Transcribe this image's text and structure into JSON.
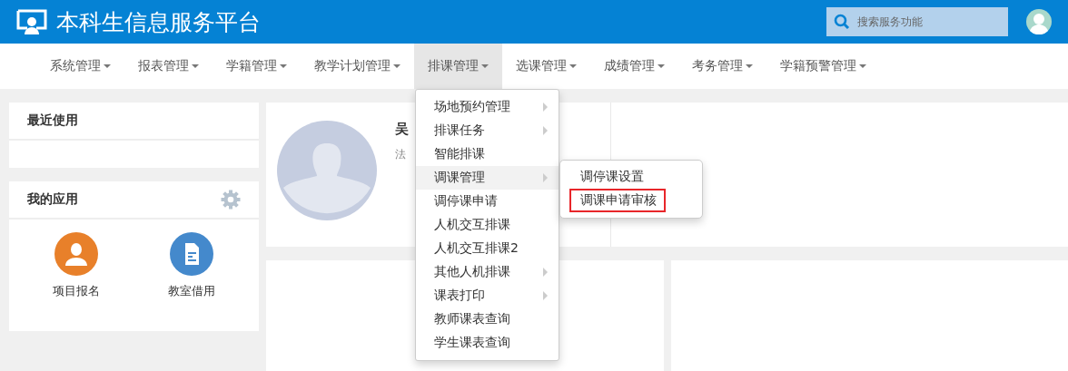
{
  "header": {
    "title": "本科生信息服务平台",
    "search": {
      "placeholder": "搜索服务功能"
    }
  },
  "nav": [
    {
      "label": "系统管理",
      "selected": false
    },
    {
      "label": "报表管理",
      "selected": false
    },
    {
      "label": "学籍管理",
      "selected": false
    },
    {
      "label": "教学计划管理",
      "selected": false
    },
    {
      "label": "排课管理",
      "selected": true
    },
    {
      "label": "选课管理",
      "selected": false
    },
    {
      "label": "成绩管理",
      "selected": false
    },
    {
      "label": "考务管理",
      "selected": false
    },
    {
      "label": "学籍预警管理",
      "selected": false
    }
  ],
  "dropdown": [
    {
      "label": "场地预约管理",
      "has_submenu": true,
      "expanded": false
    },
    {
      "label": "排课任务",
      "has_submenu": true,
      "expanded": false
    },
    {
      "label": "智能排课",
      "has_submenu": false,
      "expanded": false
    },
    {
      "label": "调课管理",
      "has_submenu": true,
      "expanded": true,
      "children": [
        {
          "label": "调停课设置",
          "marked": false
        },
        {
          "label": "调课申请审核",
          "marked": true
        }
      ]
    },
    {
      "label": "调停课申请",
      "has_submenu": false,
      "expanded": false
    },
    {
      "label": "人机交互排课",
      "has_submenu": false,
      "expanded": false
    },
    {
      "label": "人机交互排课2",
      "has_submenu": false,
      "expanded": false
    },
    {
      "label": "其他人机排课",
      "has_submenu": true,
      "expanded": false
    },
    {
      "label": "课表打印",
      "has_submenu": true,
      "expanded": false
    },
    {
      "label": "教师课表查询",
      "has_submenu": false,
      "expanded": false
    },
    {
      "label": "学生课表查询",
      "has_submenu": false,
      "expanded": false
    }
  ],
  "recent": {
    "title": "最近使用"
  },
  "apps": {
    "title": "我的应用",
    "items": [
      {
        "label": "项目报名",
        "kind": "person",
        "color": "#e8802a"
      },
      {
        "label": "教室借用",
        "kind": "document",
        "color": "#4489cc"
      }
    ]
  },
  "profile": {
    "name": "吴",
    "subtitle": "法"
  }
}
